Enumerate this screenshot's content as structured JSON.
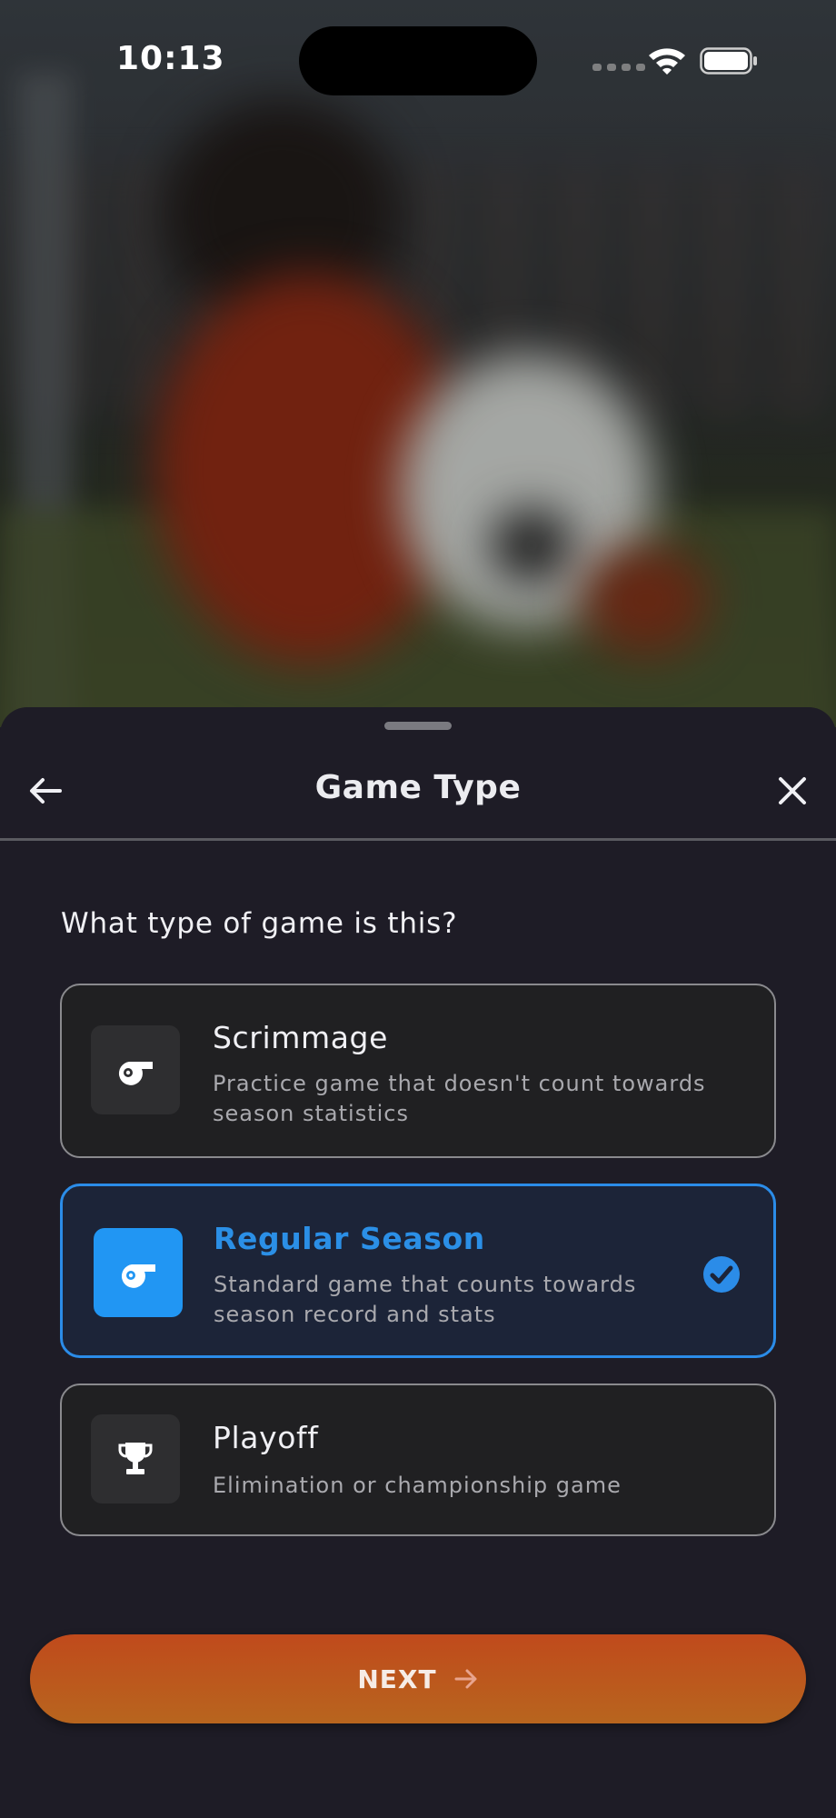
{
  "status_bar": {
    "time": "10:13"
  },
  "sheet": {
    "title": "Game Type",
    "question": "What type of game is this?",
    "options": [
      {
        "title": "Scrimmage",
        "description": "Practice game that doesn't count towards season statistics",
        "icon": "whistle-icon",
        "selected": false
      },
      {
        "title": "Regular Season",
        "description": "Standard game that counts towards season record and stats",
        "icon": "whistle-icon",
        "selected": true
      },
      {
        "title": "Playoff",
        "description": "Elimination or championship game",
        "icon": "trophy-icon",
        "selected": false
      }
    ],
    "next_label": "NEXT"
  },
  "colors": {
    "accent": "#2196f3",
    "sheet_bg": "#1e1c26",
    "button_gradient_start": "#c04a1c",
    "button_gradient_end": "#b8651e"
  }
}
